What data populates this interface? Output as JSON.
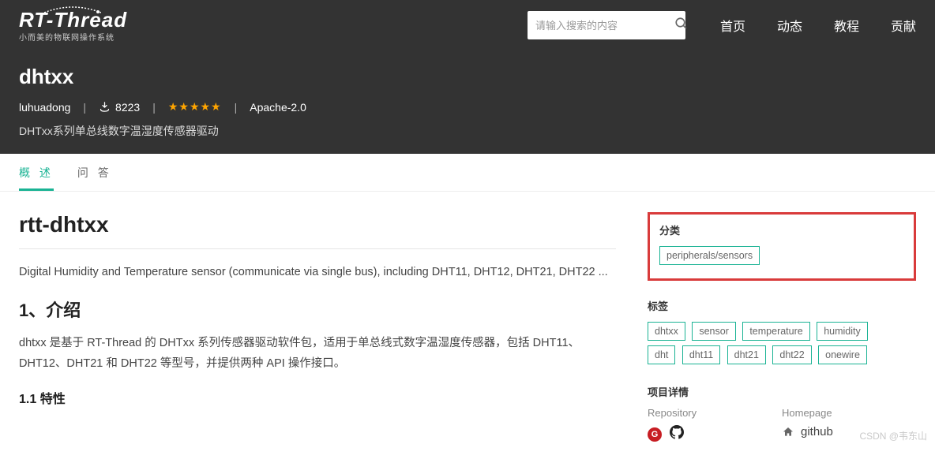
{
  "header": {
    "logo_text": "RT-Thread",
    "logo_sub": "小而美的物联网操作系统",
    "search_placeholder": "请输入搜索的内容",
    "nav": [
      "首页",
      "动态",
      "教程",
      "贡献"
    ]
  },
  "package": {
    "name": "dhtxx",
    "author": "luhuadong",
    "downloads": "8223",
    "stars": "★★★★★",
    "license": "Apache-2.0",
    "description": "DHTxx系列单总线数字温湿度传感器驱动"
  },
  "tabs": {
    "overview": "概 述",
    "qa": "问 答"
  },
  "content": {
    "title": "rtt-dhtxx",
    "intro": "Digital Humidity and Temperature sensor (communicate via single bus), including DHT11, DHT12, DHT21, DHT22 ...",
    "h2_1": "1、介绍",
    "p1": "dhtxx 是基于 RT-Thread 的 DHTxx 系列传感器驱动软件包，适用于单总线式数字温湿度传感器，包括 DHT11、DHT12、DHT21 和 DHT22 等型号，并提供两种 API 操作接口。",
    "h3_1": "1.1 特性"
  },
  "sidebar": {
    "category_title": "分类",
    "category_value": "peripherals/sensors",
    "tags_title": "标签",
    "tags": [
      "dhtxx",
      "sensor",
      "temperature",
      "humidity",
      "dht",
      "dht11",
      "dht21",
      "dht22",
      "onewire"
    ],
    "project_title": "项目详情",
    "repo_label": "Repository",
    "home_label": "Homepage",
    "home_value": "github"
  },
  "watermark": "CSDN @韦东山"
}
